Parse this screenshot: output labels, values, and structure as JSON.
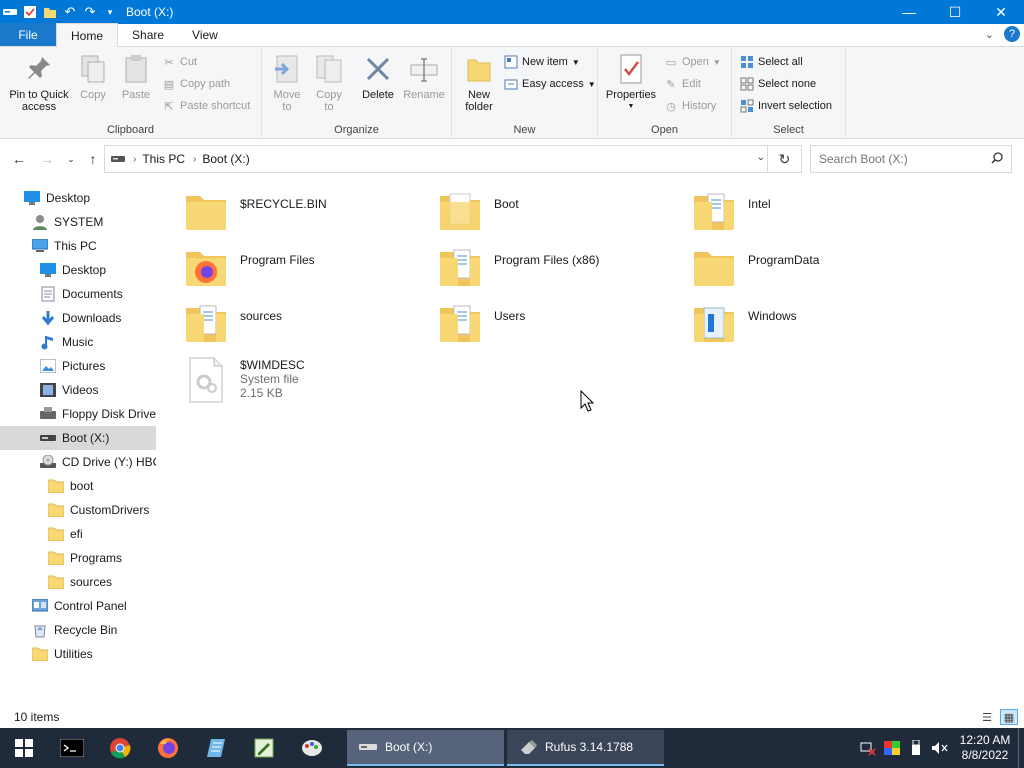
{
  "window": {
    "title": "Boot (X:)",
    "controls": {
      "minimize": "—",
      "maximize": "☐",
      "close": "✕"
    }
  },
  "ribbon_tabs": [
    "File",
    "Home",
    "Share",
    "View"
  ],
  "ribbon": {
    "clipboard": {
      "label": "Clipboard",
      "pin": "Pin to Quick access",
      "copy": "Copy",
      "paste": "Paste",
      "cut": "Cut",
      "copy_path": "Copy path",
      "paste_shortcut": "Paste shortcut"
    },
    "organize": {
      "label": "Organize",
      "move_to": "Move to",
      "copy_to": "Copy to",
      "delete": "Delete",
      "rename": "Rename"
    },
    "new": {
      "label": "New",
      "new_folder": "New folder",
      "new_item": "New item",
      "easy_access": "Easy access"
    },
    "open": {
      "label": "Open",
      "properties": "Properties",
      "open": "Open",
      "edit": "Edit",
      "history": "History"
    },
    "select": {
      "label": "Select",
      "select_all": "Select all",
      "select_none": "Select none",
      "invert_selection": "Invert selection"
    }
  },
  "address": {
    "crumbs": [
      "This PC",
      "Boot (X:)"
    ],
    "search_placeholder": "Search Boot (X:)"
  },
  "nav_tree": [
    {
      "label": "Desktop",
      "icon": "desktop-blue",
      "indent": 0
    },
    {
      "label": "SYSTEM",
      "icon": "user",
      "indent": 1
    },
    {
      "label": "This PC",
      "icon": "pc",
      "indent": 1
    },
    {
      "label": "Desktop",
      "icon": "desktop-blue",
      "indent": 2
    },
    {
      "label": "Documents",
      "icon": "documents",
      "indent": 2
    },
    {
      "label": "Downloads",
      "icon": "downloads",
      "indent": 2
    },
    {
      "label": "Music",
      "icon": "music",
      "indent": 2
    },
    {
      "label": "Pictures",
      "icon": "pictures",
      "indent": 2
    },
    {
      "label": "Videos",
      "icon": "videos",
      "indent": 2
    },
    {
      "label": "Floppy Disk Drive",
      "icon": "floppy",
      "indent": 2
    },
    {
      "label": "Boot (X:)",
      "icon": "drive",
      "indent": 2,
      "selected": true
    },
    {
      "label": "CD Drive (Y:) HBC",
      "icon": "cd",
      "indent": 2
    },
    {
      "label": "boot",
      "icon": "folder",
      "indent": 3
    },
    {
      "label": "CustomDrivers",
      "icon": "folder",
      "indent": 3
    },
    {
      "label": "efi",
      "icon": "folder",
      "indent": 3
    },
    {
      "label": "Programs",
      "icon": "folder",
      "indent": 3
    },
    {
      "label": "sources",
      "icon": "folder",
      "indent": 3
    },
    {
      "label": "Control Panel",
      "icon": "control-panel",
      "indent": 1
    },
    {
      "label": "Recycle Bin",
      "icon": "recycle",
      "indent": 1
    },
    {
      "label": "Utilities",
      "icon": "folder",
      "indent": 1
    }
  ],
  "files": [
    {
      "name": "$RECYCLE.BIN",
      "icon": "folder-empty"
    },
    {
      "name": "Boot",
      "icon": "folder-doc"
    },
    {
      "name": "Intel",
      "icon": "folder-docs"
    },
    {
      "name": "Program Files",
      "icon": "folder-firefox"
    },
    {
      "name": "Program Files (x86)",
      "icon": "folder-docs"
    },
    {
      "name": "ProgramData",
      "icon": "folder-empty"
    },
    {
      "name": "sources",
      "icon": "folder-docs"
    },
    {
      "name": "Users",
      "icon": "folder-docs"
    },
    {
      "name": "Windows",
      "icon": "folder-windows"
    },
    {
      "name": "$WIMDESC",
      "icon": "system-file",
      "type": "System file",
      "size": "2.15 KB"
    }
  ],
  "status": {
    "item_count": "10 items"
  },
  "taskbar": {
    "windows": [
      {
        "label": "Boot (X:)",
        "active": true
      },
      {
        "label": "Rufus 3.14.1788",
        "active": false
      }
    ],
    "clock_time": "12:20 AM",
    "clock_date": "8/8/2022"
  },
  "colors": {
    "titlebar": "#0078d7",
    "file_tab": "#1979ca",
    "selection": "#cce8ff",
    "folder": "#f8d775",
    "taskbar": "#1f2a3a"
  }
}
